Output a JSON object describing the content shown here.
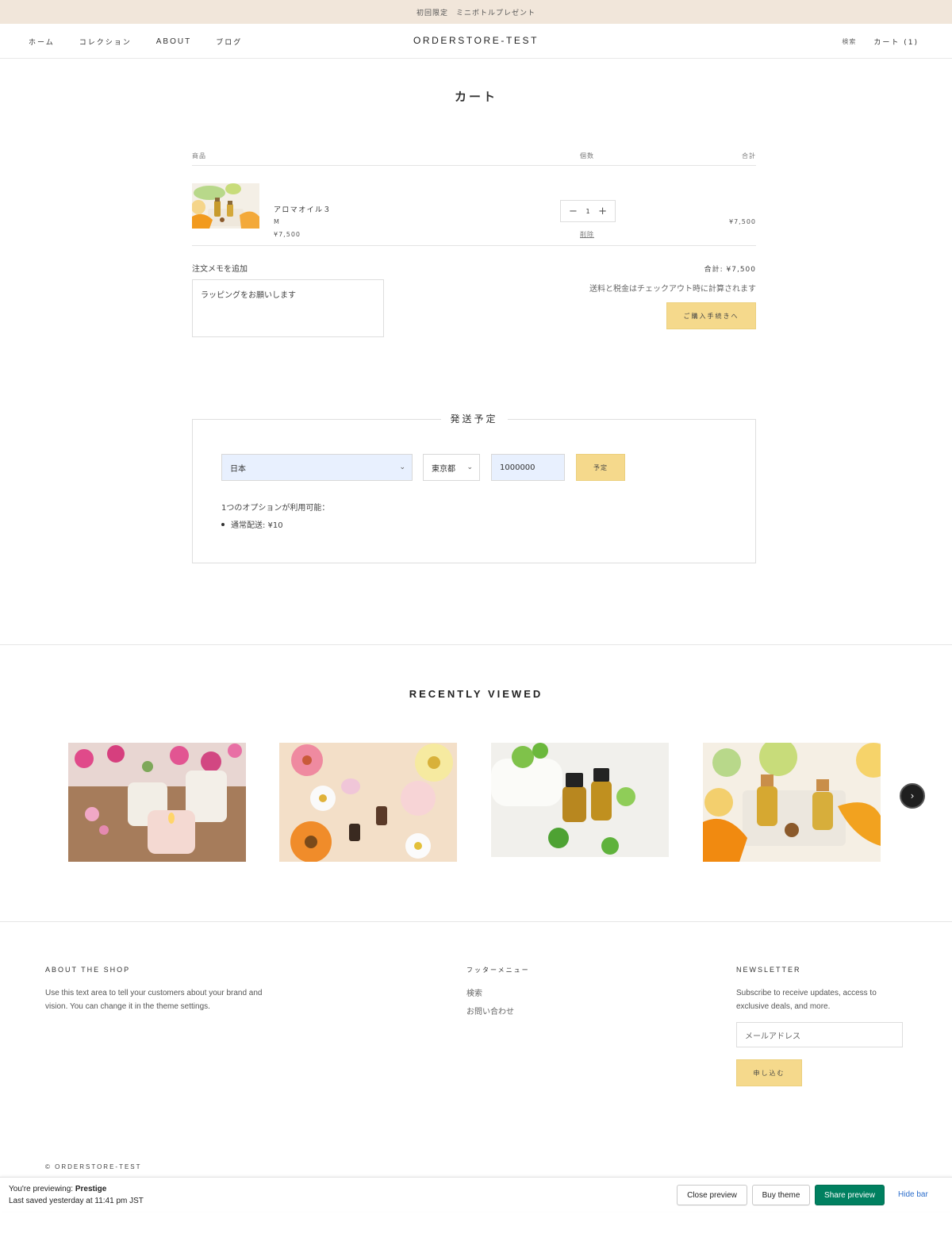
{
  "announcement": "初回限定　ミニボトルプレゼント",
  "header": {
    "nav": [
      "ホーム",
      "コレクション",
      "ABOUT",
      "ブログ"
    ],
    "logo": "ORDERSTORE-TEST",
    "search_label": "検索",
    "cart_label": "カート (1)"
  },
  "page_title": "カート",
  "cart": {
    "headers": {
      "product": "商品",
      "quantity": "個数",
      "total": "合計"
    },
    "item": {
      "name": "アロマオイル３",
      "variant": "M",
      "price": "¥7,500",
      "quantity": "1",
      "remove_label": "削除",
      "line_total": "¥7,500"
    },
    "note_label": "注文メモを追加",
    "note_value": "ラッピングをお願いします",
    "subtotal": "合計: ¥7,500",
    "tax_note": "送料と税金はチェックアウト時に計算されます",
    "checkout_label": "ご購入手続きへ"
  },
  "shipping": {
    "title": "発送予定",
    "country": "日本",
    "prefecture": "東京都",
    "zip": "1000000",
    "estimate_label": "予定",
    "available": "1つのオプションが利用可能：",
    "option": "通常配送: ¥10"
  },
  "recently_viewed": {
    "title": "RECENTLY VIEWED"
  },
  "footer": {
    "about_title": "ABOUT THE SHOP",
    "about_text_1": "Use this text area to tell your customers about your brand and",
    "about_text_2": "vision. You can change it in the theme settings.",
    "menu_title": "フッターメニュー",
    "menu_items": [
      "検索",
      "お問い合わせ"
    ],
    "newsletter_title": "NEWSLETTER",
    "newsletter_text_1": "Subscribe to receive updates, access to",
    "newsletter_text_2": "exclusive deals, and more.",
    "email_placeholder": "メールアドレス",
    "subscribe_label": "申し込む",
    "copyright": "© ORDERSTORE-TEST"
  },
  "preview_bar": {
    "previewing_prefix": "You're previewing:",
    "theme_name": "Prestige",
    "saved": "Last saved yesterday at 11:41 pm JST",
    "close": "Close preview",
    "buy": "Buy theme",
    "share": "Share preview",
    "hide": "Hide bar"
  },
  "colors": {
    "announcement_bg": "#f1e6da",
    "button_yellow": "#f5d98c",
    "share_green": "#008060",
    "link_blue": "#2c6ecb"
  }
}
